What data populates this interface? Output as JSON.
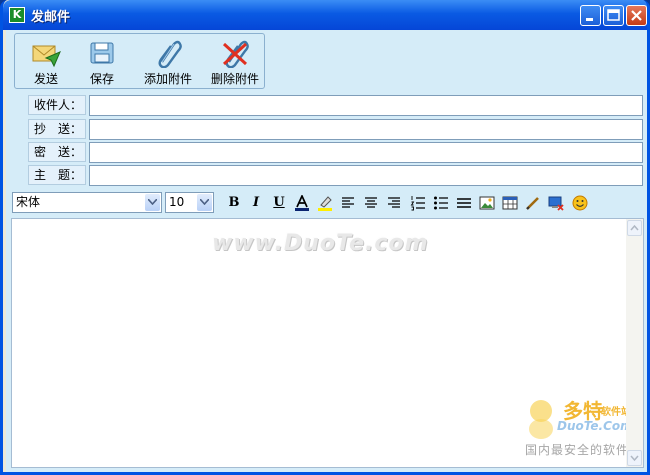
{
  "window": {
    "title": "发邮件",
    "app_icon_letter": "K"
  },
  "toolbar": {
    "send_label": "发送",
    "save_label": "保存",
    "attach_label": "添加附件",
    "remove_attach_label": "删除附件"
  },
  "fields": {
    "to_label": "收件人：",
    "cc_label": "抄　送：",
    "bcc_label": "密　送：",
    "subject_label": "主　题：",
    "to_value": "",
    "cc_value": "",
    "bcc_value": "",
    "subject_value": ""
  },
  "format_bar": {
    "font_name": "宋体",
    "font_size": "10",
    "bold": "B",
    "italic": "I",
    "underline": "U"
  },
  "watermark": {
    "center": "www.DuoTe.com",
    "logo_big": "多特",
    "logo_small": "软件站",
    "logo_url": "DuoTe.Com",
    "slogan": "国内最安全的软件站"
  },
  "colors": {
    "titlebar": "#0a5ae3",
    "client_bg": "#d5ecf8",
    "close_button": "#c43b17"
  }
}
